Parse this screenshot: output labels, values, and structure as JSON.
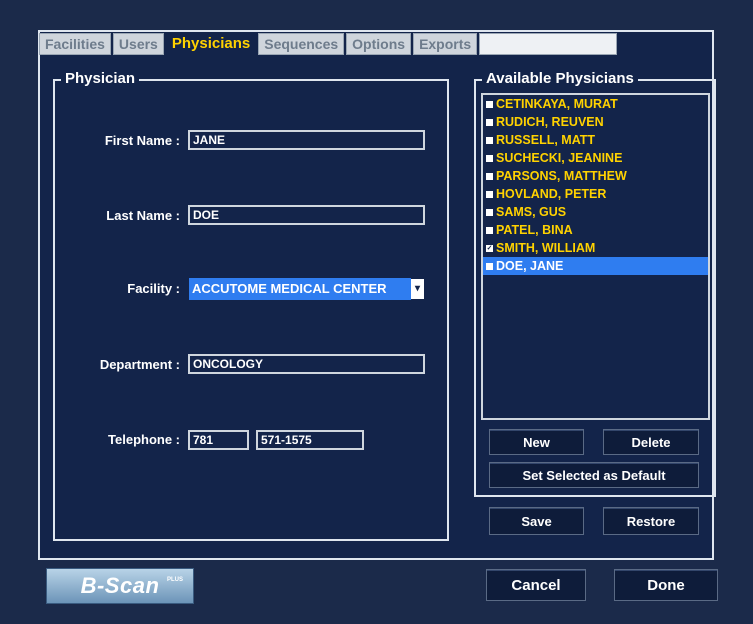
{
  "tabs": [
    "Facilities",
    "Users",
    "Physicians",
    "Sequences",
    "Options",
    "Exports"
  ],
  "physician": {
    "group_title": "Physician",
    "first_name_label": "First Name :",
    "first_name": "JANE",
    "last_name_label": "Last Name :",
    "last_name": "DOE",
    "facility_label": "Facility :",
    "facility": "ACCUTOME MEDICAL CENTER",
    "department_label": "Department :",
    "department": "ONCOLOGY",
    "telephone_label": "Telephone :",
    "phone_area": "781",
    "phone_number": "571-1575"
  },
  "available": {
    "group_title": "Available Physicians",
    "items": [
      "CETINKAYA, MURAT",
      "RUDICH, REUVEN",
      "RUSSELL, MATT",
      "SUCHECKI, JEANINE",
      "PARSONS, MATTHEW",
      "HOVLAND, PETER",
      "SAMS, GUS",
      "PATEL, BINA",
      "SMITH, WILLIAM",
      "DOE, JANE"
    ],
    "selected_index": 9,
    "checked_index": 8,
    "new_label": "New",
    "delete_label": "Delete",
    "set_default_label": "Set Selected as Default"
  },
  "actions": {
    "save_label": "Save",
    "restore_label": "Restore",
    "cancel_label": "Cancel",
    "done_label": "Done"
  },
  "logo": {
    "text": "B-Scan",
    "plus": "PLUS"
  },
  "colors": {
    "background": "#13244a",
    "active_tab_text": "#ffd200",
    "list_text": "#ffd200",
    "selection": "#2f7df0"
  }
}
